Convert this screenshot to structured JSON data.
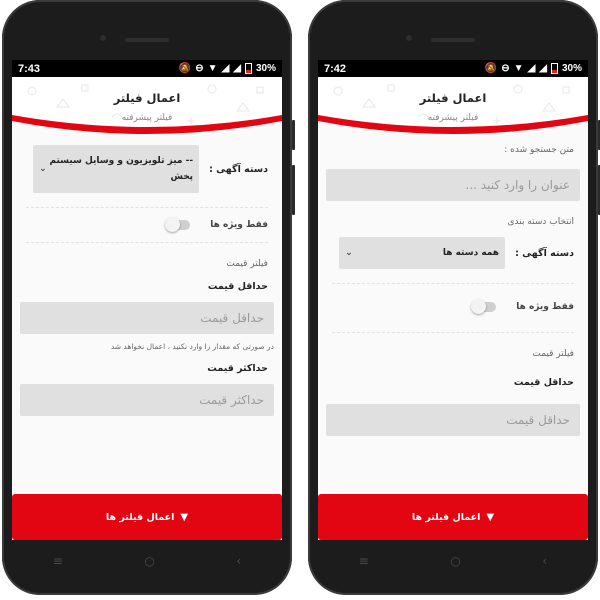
{
  "phones": [
    {
      "status": {
        "time": "7:43",
        "battery": "30%"
      },
      "header": {
        "title": "اعمال فیلتر",
        "subtitle": "فیلتر پیشرفته"
      },
      "category": {
        "label": "دسته آگهی :",
        "value": "-- میز تلویزیون و وسایل سیستم پخش"
      },
      "special_only": "فقط ویژه ها",
      "price_filter": "فیلتر قیمت",
      "min_price": {
        "label": "حداقل قیمت",
        "placeholder": "حداقل قیمت"
      },
      "help_text": "در صورتی که مقدار را وارد نکنید ، اعمال نخواهد شد",
      "max_price": {
        "label": "حداکثر قیمت",
        "placeholder": "حداکثر قیمت"
      },
      "apply_label": "اعمال فیلتر ها"
    },
    {
      "status": {
        "time": "7:42",
        "battery": "30%"
      },
      "header": {
        "title": "اعمال فیلتر",
        "subtitle": "فیلتر پیشرفته"
      },
      "search": {
        "label": "متن جستجو شده :",
        "placeholder": "عنوان را وارد کنید ..."
      },
      "select_category": "انتخاب دسته بندی",
      "category": {
        "label": "دسته آگهی :",
        "value": "همه دسته ها"
      },
      "special_only": "فقط ویژه ها",
      "price_filter": "فیلتر قیمت",
      "min_price": {
        "label": "حداقل قیمت",
        "placeholder": "حداقل قیمت"
      },
      "apply_label": "اعمال فیلتر ها"
    }
  ],
  "icons": {
    "funnel": "funnel-icon",
    "chevron": "chevron-down-icon"
  },
  "colors": {
    "accent": "#e20613",
    "status_bar": "#000000",
    "field": "#e0e0e0"
  }
}
